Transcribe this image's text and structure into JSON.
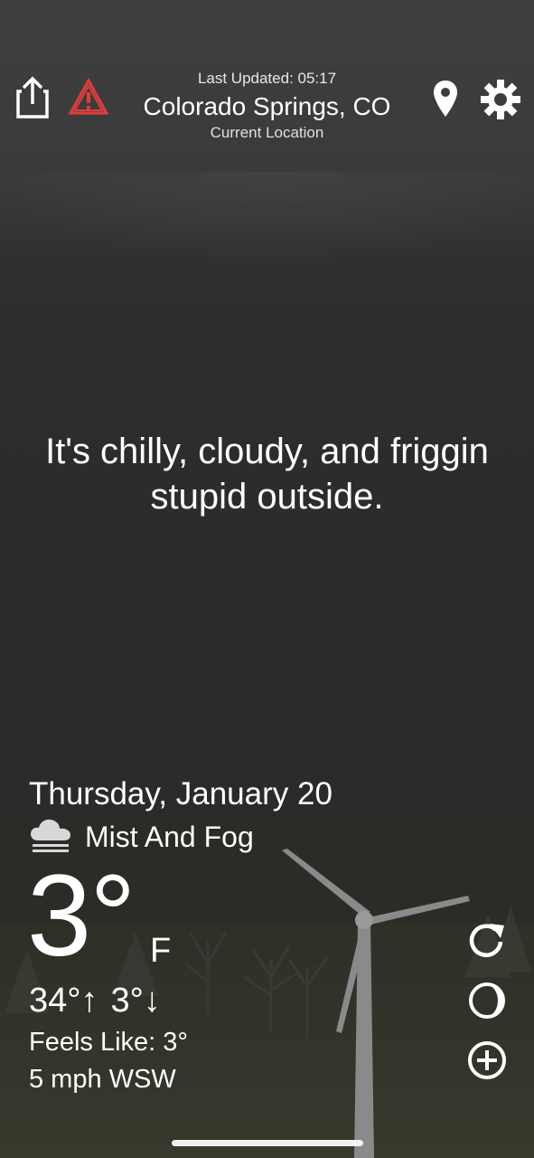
{
  "header": {
    "last_updated": "Last Updated: 05:17",
    "city": "Colorado Springs, CO",
    "location_type": "Current Location",
    "icons": [
      "share-icon",
      "alert-icon",
      "location-pin-icon",
      "gear-icon"
    ]
  },
  "message": {
    "line1": "It's chilly, cloudy, and friggin",
    "line2": "stupid outside."
  },
  "weather": {
    "date": "Thursday, January 20",
    "condition": "Mist And Fog",
    "condition_icon": "fog-icon",
    "temperature": "3°",
    "unit": "F",
    "high": "34°",
    "high_arrow": "↑",
    "low": "3°",
    "low_arrow": "↓",
    "feels_like": "Feels Like: 3°",
    "wind": "5 mph WSW"
  },
  "side_buttons": [
    "refresh-icon",
    "moon-phase-icon",
    "add-icon"
  ],
  "colors": {
    "alert_red": "#e23b3b",
    "text": "#ffffff",
    "background": "#2b2b2b"
  }
}
